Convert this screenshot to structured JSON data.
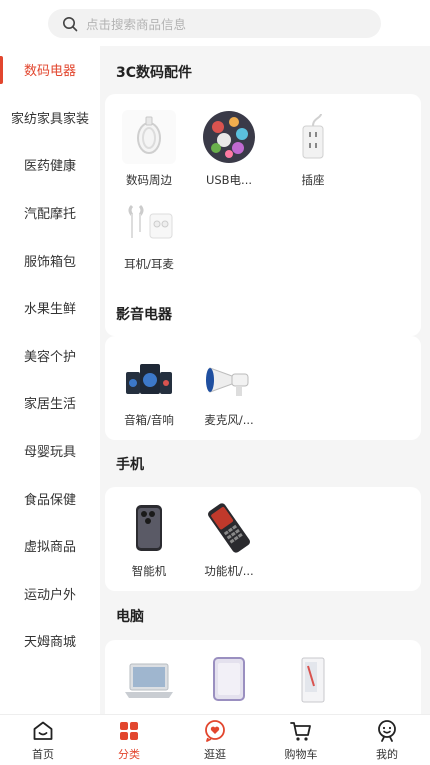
{
  "search": {
    "placeholder": "点击搜索商品信息"
  },
  "sidebar": {
    "items": [
      {
        "label": "数码电器",
        "active": true
      },
      {
        "label": "家纺家具家装",
        "active": false
      },
      {
        "label": "医药健康",
        "active": false
      },
      {
        "label": "汽配摩托",
        "active": false
      },
      {
        "label": "服饰箱包",
        "active": false
      },
      {
        "label": "水果生鲜",
        "active": false
      },
      {
        "label": "美容个护",
        "active": false
      },
      {
        "label": "家居生活",
        "active": false
      },
      {
        "label": "母婴玩具",
        "active": false
      },
      {
        "label": "食品保健",
        "active": false
      },
      {
        "label": "虚拟商品",
        "active": false
      },
      {
        "label": "运动户外",
        "active": false
      },
      {
        "label": "天姆商城",
        "active": false
      }
    ]
  },
  "sections": [
    {
      "title": "3C数码配件",
      "items": [
        {
          "label": "数码周边",
          "icon": "cable-icon"
        },
        {
          "label": "USB电...",
          "icon": "sticker-ball-icon"
        },
        {
          "label": "插座",
          "icon": "power-strip-icon"
        },
        {
          "label": "耳机/耳麦",
          "icon": "earphones-icon"
        }
      ]
    },
    {
      "title": "影音电器",
      "items": [
        {
          "label": "音箱/音响",
          "icon": "speaker-set-icon"
        },
        {
          "label": "麦克风/...",
          "icon": "megaphone-icon"
        }
      ]
    },
    {
      "title": "手机",
      "items": [
        {
          "label": "智能机",
          "icon": "smartphone-icon"
        },
        {
          "label": "功能机/...",
          "icon": "feature-phone-icon"
        }
      ]
    },
    {
      "title": "电脑",
      "items": [
        {
          "label": "",
          "icon": "laptop-icon"
        },
        {
          "label": "",
          "icon": "tablet-icon"
        },
        {
          "label": "",
          "icon": "desktop-tower-icon"
        }
      ]
    }
  ],
  "tabbar": {
    "items": [
      {
        "label": "首页",
        "icon": "home-icon",
        "active": false
      },
      {
        "label": "分类",
        "icon": "category-icon",
        "active": true
      },
      {
        "label": "逛逛",
        "icon": "heart-bubble-icon",
        "active": false
      },
      {
        "label": "购物车",
        "icon": "cart-icon",
        "active": false
      },
      {
        "label": "我的",
        "icon": "profile-icon",
        "active": false
      }
    ]
  },
  "colors": {
    "accent": "#e2462e",
    "background": "#f5f5f5",
    "sidebar": "#ffffff"
  }
}
